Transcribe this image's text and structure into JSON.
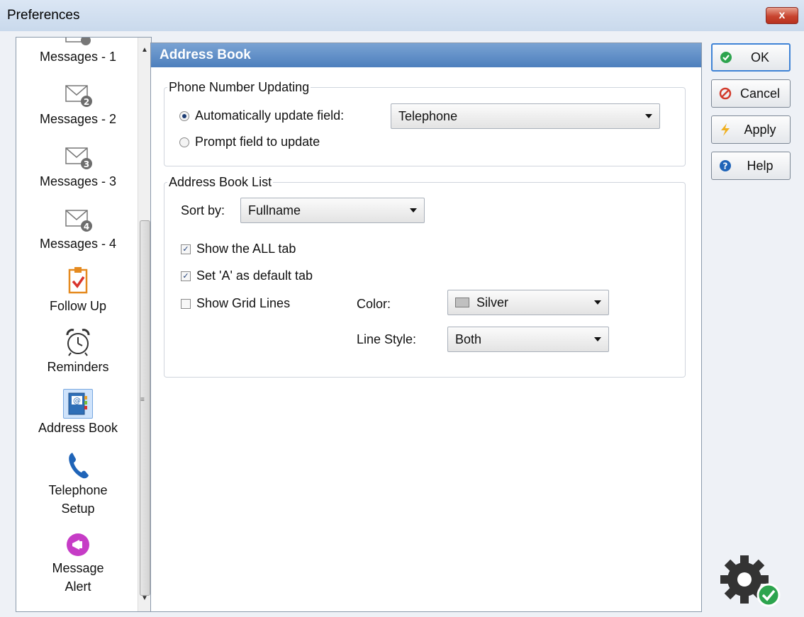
{
  "window": {
    "title": "Preferences",
    "close_glyph": "x"
  },
  "nav": {
    "items": [
      {
        "label": "Messages - 1",
        "icon": "envelope-icon"
      },
      {
        "label": "Messages - 2",
        "icon": "envelope-icon",
        "badge": "2"
      },
      {
        "label": "Messages - 3",
        "icon": "envelope-icon",
        "badge": "3"
      },
      {
        "label": "Messages - 4",
        "icon": "envelope-icon",
        "badge": "4"
      },
      {
        "label": "Follow Up",
        "icon": "clipboard-check-icon"
      },
      {
        "label": "Reminders",
        "icon": "alarm-clock-icon"
      },
      {
        "label": "Address Book",
        "icon": "address-book-icon",
        "selected": true
      },
      {
        "label": "Telephone",
        "label2": "Setup",
        "icon": "phone-icon"
      },
      {
        "label": "Message",
        "label2": "Alert",
        "icon": "megaphone-icon"
      }
    ]
  },
  "pane": {
    "title": "Address Book",
    "phone_group": {
      "legend": "Phone Number Updating",
      "auto_label": "Automatically update field:",
      "auto_checked": true,
      "field_value": "Telephone",
      "prompt_label": "Prompt field to update",
      "prompt_checked": false
    },
    "list_group": {
      "legend": "Address Book List",
      "sort_label": "Sort by:",
      "sort_value": "Fullname",
      "show_all_label": "Show the ALL tab",
      "show_all_checked": true,
      "default_tab_label": "Set 'A' as default tab",
      "default_tab_checked": true,
      "grid_lines_label": "Show Grid Lines",
      "grid_lines_checked": false,
      "color_label": "Color:",
      "color_value": "Silver",
      "line_style_label": "Line Style:",
      "line_style_value": "Both"
    }
  },
  "buttons": {
    "ok": "OK",
    "cancel": "Cancel",
    "apply": "Apply",
    "help": "Help"
  },
  "colors": {
    "header": "#4d7fbd",
    "ok_icon": "#2da44e",
    "cancel_icon": "#d23b2c",
    "apply_icon": "#f0b020",
    "help_icon": "#1f64b8",
    "swatch": "#c0c0c0"
  }
}
